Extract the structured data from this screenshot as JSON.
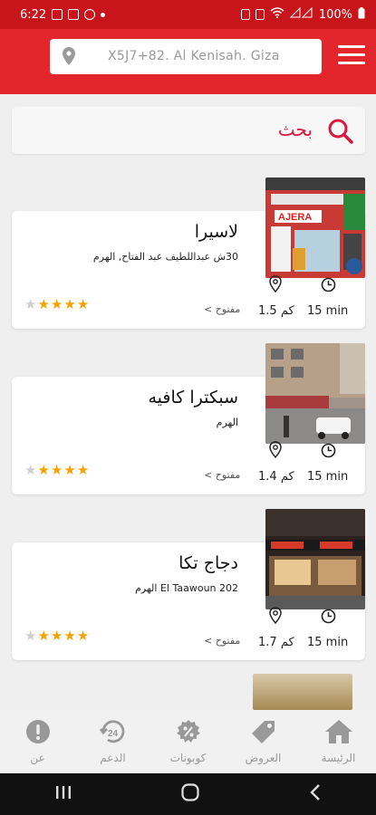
{
  "status_bar": {
    "time": "6:22",
    "battery": "100%"
  },
  "header": {
    "location_text": "X5J7+82. Al Kenisah. Giza"
  },
  "search": {
    "label": "بحث"
  },
  "cards": [
    {
      "name": "لاسيرا",
      "address": "30ش عبداللطيف عبد الفتاح, الهرم",
      "distance": "1.5 كم",
      "time": "15 min",
      "status": "مفتوح",
      "rating": 4
    },
    {
      "name": "سبكترا كافيه",
      "address": "الهرم",
      "distance": "1.4 كم",
      "time": "15 min",
      "status": "مفتوح",
      "rating": 4
    },
    {
      "name": "دجاج تكا",
      "address": "El Taawoun 202 الهرم",
      "distance": "1.7 كم",
      "time": "15 min",
      "status": "مفتوح",
      "rating": 4
    }
  ],
  "photo_signs": {
    "card1": "AJERA"
  },
  "bottom_nav": [
    {
      "label": "عن",
      "icon": "info-icon"
    },
    {
      "label": "الدعم",
      "icon": "support-24-icon"
    },
    {
      "label": "كوبونات",
      "icon": "coupon-icon"
    },
    {
      "label": "العروض",
      "icon": "tag-icon"
    },
    {
      "label": "الرئيسة",
      "icon": "home-icon"
    }
  ],
  "colors": {
    "brand_red": "#e2262b",
    "status_red": "#c8151b",
    "accent_pink": "#d7193f",
    "star": "#f5a200"
  }
}
